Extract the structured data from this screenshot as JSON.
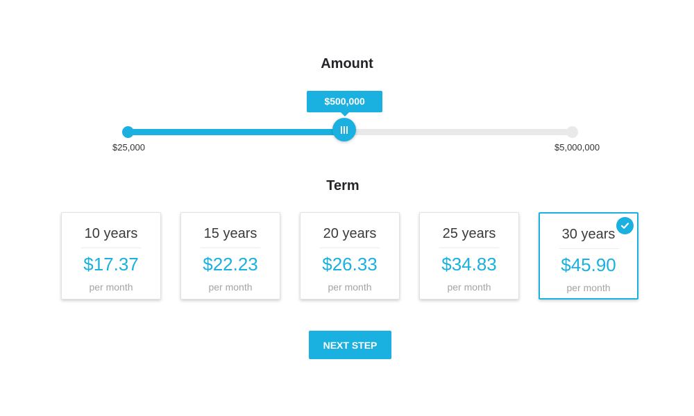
{
  "amount": {
    "heading": "Amount",
    "slider": {
      "min_label": "$25,000",
      "max_label": "$5,000,000",
      "value_label": "$500,000",
      "fill_fraction": 0.487
    }
  },
  "term": {
    "heading": "Term",
    "options": [
      {
        "years": "10 years",
        "price": "$17.37",
        "unit": "per month",
        "selected": false
      },
      {
        "years": "15 years",
        "price": "$22.23",
        "unit": "per month",
        "selected": false
      },
      {
        "years": "20 years",
        "price": "$26.33",
        "unit": "per month",
        "selected": false
      },
      {
        "years": "25 years",
        "price": "$34.83",
        "unit": "per month",
        "selected": false
      },
      {
        "years": "30 years",
        "price": "$45.90",
        "unit": "per month",
        "selected": true
      }
    ]
  },
  "actions": {
    "next_label": "NEXT STEP"
  },
  "colors": {
    "accent": "#1ab0e0",
    "track": "#e9e9e9",
    "muted_text": "#a3a3a3"
  },
  "icons": {
    "slider_handle": "grip-lines-icon",
    "selected_badge": "check-icon"
  }
}
